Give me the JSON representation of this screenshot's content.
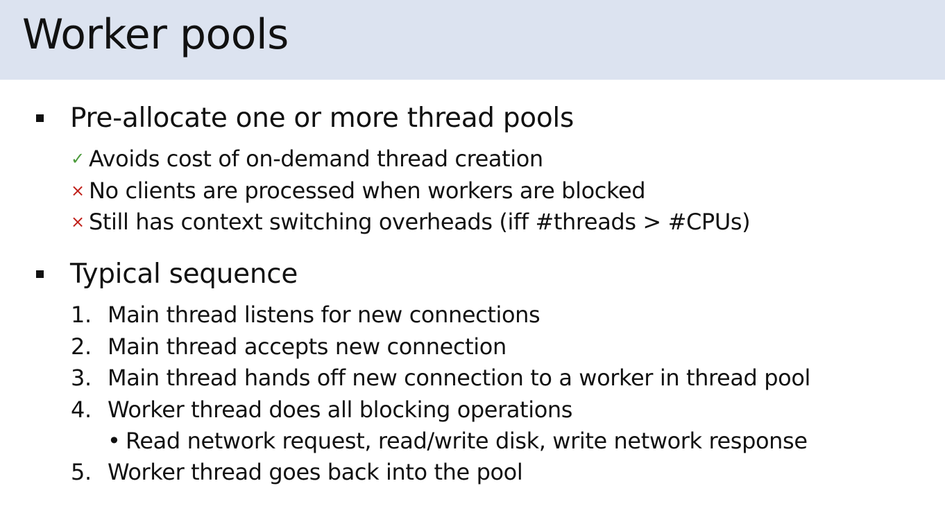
{
  "slide": {
    "title": "Worker pools"
  },
  "section1": {
    "heading": "Pre-allocate one or more thread pools",
    "points": [
      {
        "mark": "✓",
        "text": "Avoids cost of on-demand thread creation"
      },
      {
        "mark": "×",
        "text": "No clients are processed when workers are blocked"
      },
      {
        "mark": "×",
        "text": "Still has context switching overheads (iff #threads > #CPUs)"
      }
    ]
  },
  "section2": {
    "heading": "Typical sequence",
    "steps": [
      {
        "num": "1.",
        "text": "Main thread listens for new connections"
      },
      {
        "num": "2.",
        "text": "Main thread accepts new connection"
      },
      {
        "num": "3.",
        "text": "Main thread hands off new connection to a worker in thread pool"
      },
      {
        "num": "4.",
        "text": "Worker thread does all blocking operations"
      },
      {
        "num": "5.",
        "text": "Worker thread goes back into the pool"
      }
    ],
    "step4_detail": {
      "bullet": "•",
      "text": "Read network request, read/write disk, write network response"
    }
  },
  "colors": {
    "title_band": "#dce3f0",
    "check_mark": "#4a9a3a",
    "cross_mark": "#c0201a"
  }
}
